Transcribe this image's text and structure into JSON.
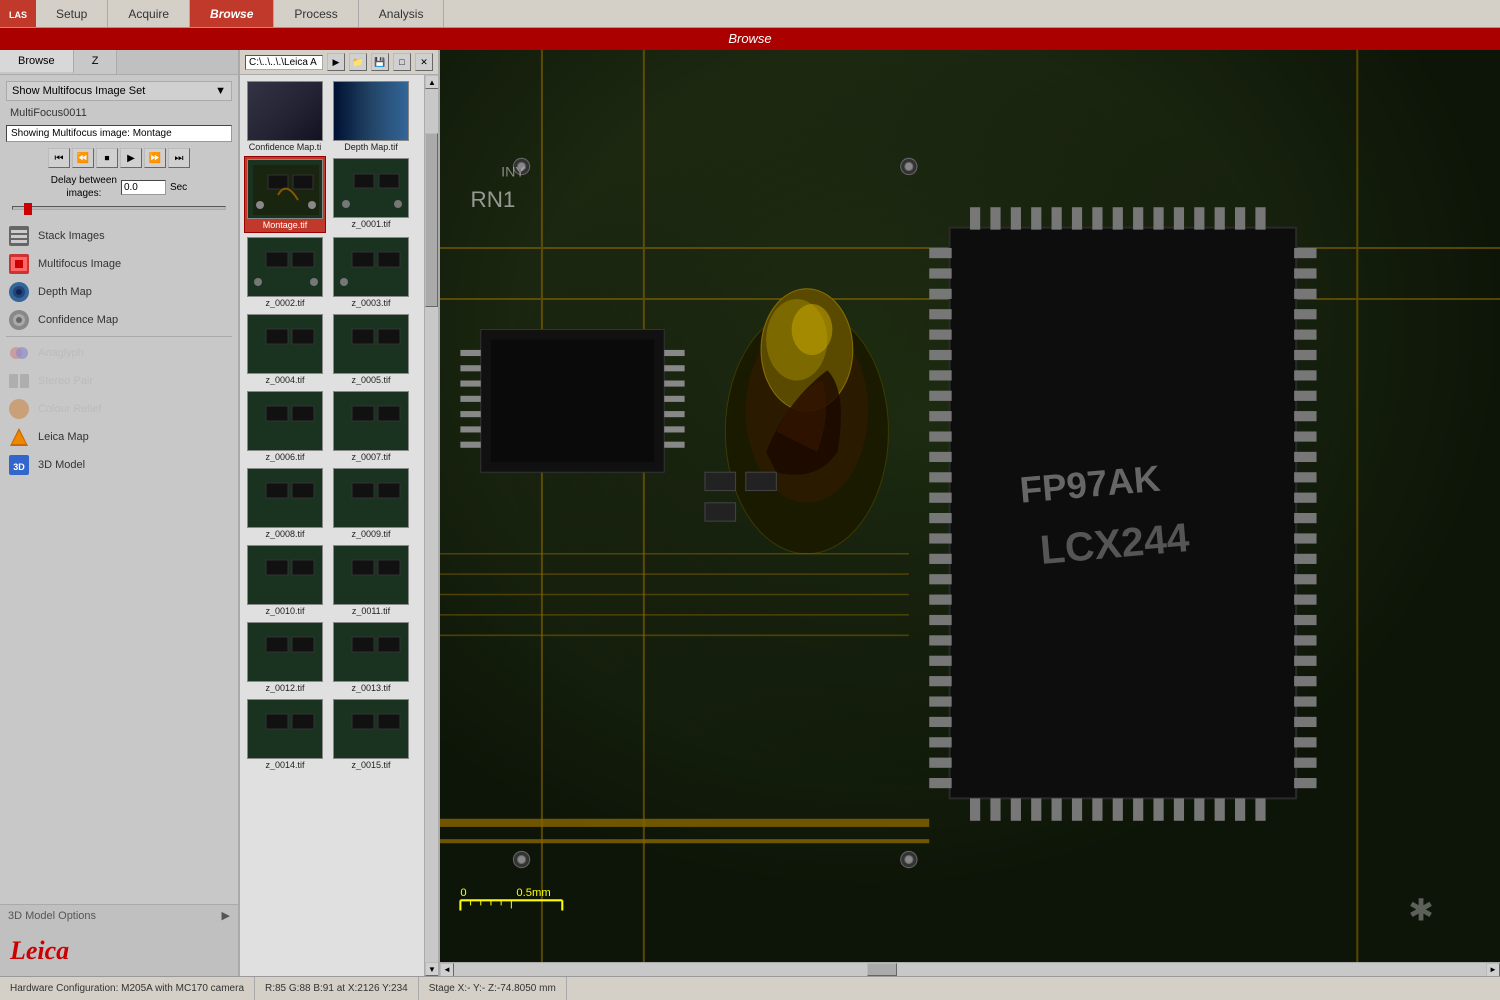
{
  "app": {
    "title": "Browse",
    "title_bar": "Browse"
  },
  "nav": {
    "logo": "L",
    "items": [
      {
        "label": "Setup",
        "active": false
      },
      {
        "label": "Acquire",
        "active": false
      },
      {
        "label": "Browse",
        "active": true
      },
      {
        "label": "Process",
        "active": false
      },
      {
        "label": "Analysis",
        "active": false
      }
    ]
  },
  "left_panel": {
    "tabs": [
      {
        "label": "Browse",
        "active": true
      },
      {
        "label": "Z",
        "active": false
      }
    ],
    "show_multifocus_label": "Show Multifocus Image Set",
    "multifocus_name": "MultiFocus0011",
    "showing_label": "Showing Multifocus image: Montage",
    "playback_buttons": [
      "⏮",
      "⏪",
      "⏹",
      "▶",
      "⏩",
      "⏭"
    ],
    "delay_label": "Delay between\nimages:",
    "delay_value": "0.0",
    "delay_unit": "Sec",
    "sidebar_items": [
      {
        "id": "stack-images",
        "label": "Stack Images",
        "icon_color": "#555",
        "enabled": true
      },
      {
        "id": "multifocus-image",
        "label": "Multifocus Image",
        "icon_color": "#cc3333",
        "enabled": true
      },
      {
        "id": "depth-map",
        "label": "Depth Map",
        "icon_color": "#336699",
        "enabled": true
      },
      {
        "id": "confidence-map",
        "label": "Confidence Map",
        "icon_color": "#aaaaaa",
        "enabled": true
      },
      {
        "id": "anaglyph",
        "label": "Anaglyph",
        "icon_color": "#888",
        "enabled": false
      },
      {
        "id": "stereo-pair",
        "label": "Stereo Pair",
        "icon_color": "#888",
        "enabled": false
      },
      {
        "id": "colour-relief",
        "label": "Colour Relief",
        "icon_color": "#888",
        "enabled": false
      },
      {
        "id": "leica-map",
        "label": "Leica Map",
        "icon_color": "#cc6600",
        "enabled": true
      },
      {
        "id": "3d-model",
        "label": "3D Model",
        "icon_color": "#3366cc",
        "enabled": true
      }
    ],
    "d3_options_label": "3D Model Options"
  },
  "file_browser": {
    "path": "C:\\..\\..\\.\\Leica A",
    "files": [
      {
        "name": "Confidence Map.ti",
        "type": "confidence",
        "row": 0,
        "col": 0
      },
      {
        "name": "Depth Map.tif",
        "type": "depth",
        "row": 0,
        "col": 1
      },
      {
        "name": "Montage.tif",
        "type": "pcb",
        "selected": true,
        "row": 1,
        "col": 0
      },
      {
        "name": "z_0001.tif",
        "type": "pcb",
        "row": 1,
        "col": 1
      },
      {
        "name": "z_0002.tif",
        "type": "pcb",
        "row": 2,
        "col": 0
      },
      {
        "name": "z_0003.tif",
        "type": "pcb",
        "row": 2,
        "col": 1
      },
      {
        "name": "z_0004.tif",
        "type": "pcb",
        "row": 3,
        "col": 0
      },
      {
        "name": "z_0005.tif",
        "type": "pcb",
        "row": 3,
        "col": 1
      },
      {
        "name": "z_0006.tif",
        "type": "pcb",
        "row": 4,
        "col": 0
      },
      {
        "name": "z_0007.tif",
        "type": "pcb",
        "row": 4,
        "col": 1
      },
      {
        "name": "z_0008.tif",
        "type": "pcb",
        "row": 5,
        "col": 0
      },
      {
        "name": "z_0009.tif",
        "type": "pcb",
        "row": 5,
        "col": 1
      },
      {
        "name": "z_0010.tif",
        "type": "pcb",
        "row": 6,
        "col": 0
      },
      {
        "name": "z_0011.tif",
        "type": "pcb",
        "row": 6,
        "col": 1
      },
      {
        "name": "z_0012.tif",
        "type": "pcb",
        "row": 7,
        "col": 0
      },
      {
        "name": "z_0013.tif",
        "type": "pcb",
        "row": 7,
        "col": 1
      },
      {
        "name": "z_0014.tif",
        "type": "pcb",
        "row": 8,
        "col": 0
      },
      {
        "name": "z_0015.tif",
        "type": "pcb",
        "row": 8,
        "col": 1
      }
    ]
  },
  "status_bar": {
    "hardware": "Hardware Configuration: M205A with MC170 camera",
    "coords": "R:85  G:88  B:91  at  X:2126  Y:234",
    "stage": "Stage X:-  Y:-  Z:-74.8050 mm"
  },
  "scale_bar": {
    "label": "0       0.5mm"
  }
}
